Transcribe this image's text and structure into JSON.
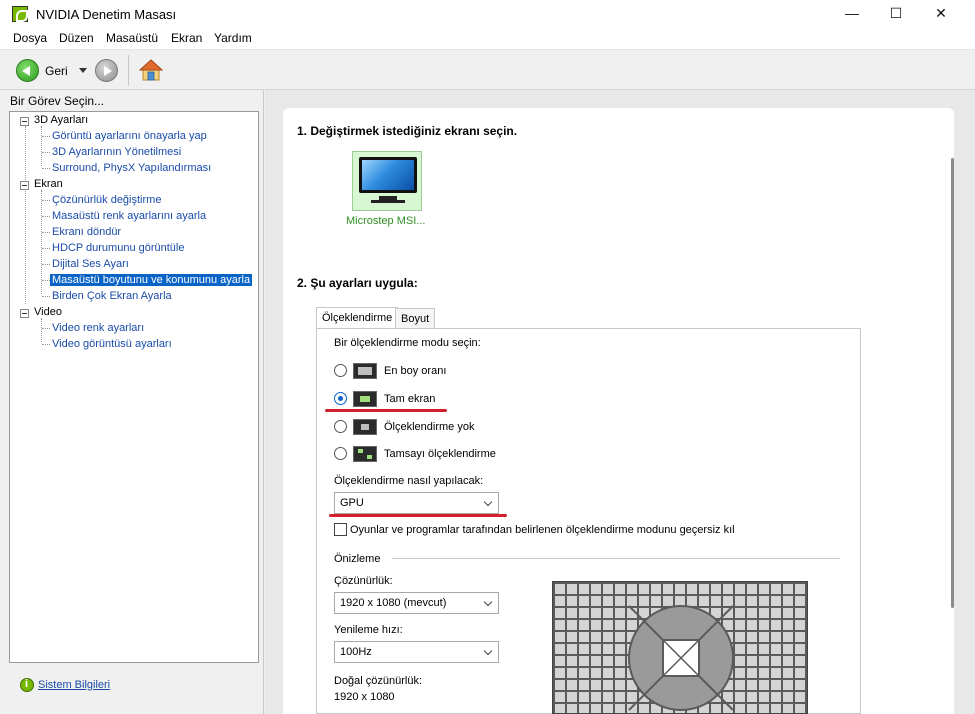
{
  "window": {
    "title": "NVIDIA Denetim Masası",
    "minimize": "—",
    "maximize": "☐",
    "close": "✕"
  },
  "menu": [
    "Dosya",
    "Düzen",
    "Masaüstü",
    "Ekran",
    "Yardım"
  ],
  "toolbar": {
    "back_label": "Geri"
  },
  "left": {
    "header": "Bir Görev Seçin...",
    "tree": [
      {
        "label": "3D Ayarları",
        "children": [
          "Görüntü ayarlarını önayarla yap",
          "3D Ayarlarının Yönetilmesi",
          "Surround, PhysX Yapılandırması"
        ]
      },
      {
        "label": "Ekran",
        "children": [
          "Çözünürlük değiştirme",
          "Masaüstü renk ayarlarını ayarla",
          "Ekranı döndür",
          "HDCP durumunu görüntüle",
          "Dijital Ses Ayarı",
          "Masaüstü boyutunu ve konumunu ayarla",
          "Birden Çok Ekran Ayarla"
        ]
      },
      {
        "label": "Video",
        "children": [
          "Video renk ayarları",
          "Video görüntüsü ayarları"
        ]
      }
    ],
    "selected": "Masaüstü boyutunu ve konumunu ayarla",
    "system_info": "Sistem Bilgileri"
  },
  "content": {
    "step1": "1. Değiştirmek istediğiniz ekranı seçin.",
    "display_name": "Microstep MSI...",
    "step2": "2. Şu ayarları uygula:",
    "tabs": [
      "Ölçeklendirme",
      "Boyut"
    ],
    "scaling_prompt": "Bir ölçeklendirme modu seçin:",
    "modes": [
      {
        "label": "En boy oranı",
        "checked": false
      },
      {
        "label": "Tam ekran",
        "checked": true
      },
      {
        "label": "Ölçeklendirme yok",
        "checked": false
      },
      {
        "label": "Tamsayı ölçeklendirme",
        "checked": false
      }
    ],
    "perform_label": "Ölçeklendirme nasıl yapılacak:",
    "perform_value": "GPU",
    "override_label": "Oyunlar ve programlar tarafından belirlenen ölçeklendirme modunu geçersiz kıl",
    "override_checked": false,
    "preview_label": "Önizleme",
    "resolution_label": "Çözünürlük:",
    "resolution_value": "1920 x 1080 (mevcut)",
    "refresh_label": "Yenileme hızı:",
    "refresh_value": "100Hz",
    "native_label": "Doğal çözünürlük:",
    "native_value": "1920 x 1080"
  }
}
